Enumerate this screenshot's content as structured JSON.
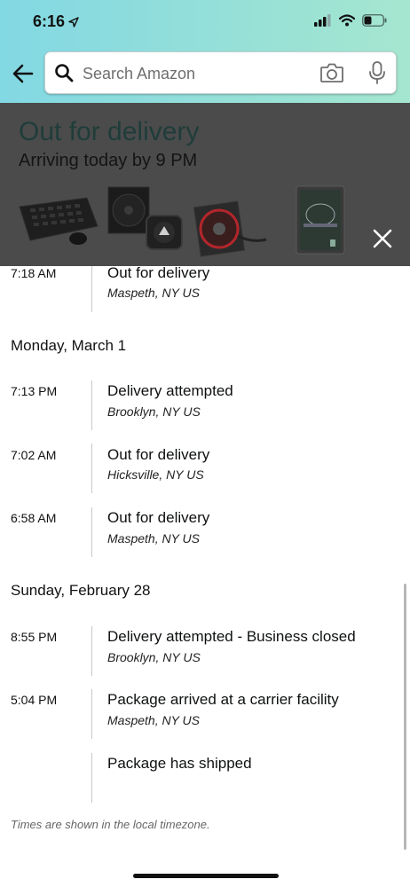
{
  "status_bar": {
    "time": "6:16"
  },
  "search": {
    "placeholder": "Search Amazon"
  },
  "banner": {
    "title": "Out for delivery",
    "subtitle": "Arriving today by 9 PM"
  },
  "timeline": {
    "first_event": {
      "time": "7:18 AM",
      "event": "Out for delivery",
      "location": "Maspeth, NY US"
    },
    "day1": {
      "header": "Monday, March 1",
      "events": [
        {
          "time": "7:13 PM",
          "event": "Delivery attempted",
          "location": "Brooklyn, NY US"
        },
        {
          "time": "7:02 AM",
          "event": "Out for delivery",
          "location": "Hicksville, NY US"
        },
        {
          "time": "6:58 AM",
          "event": "Out for delivery",
          "location": "Maspeth, NY US"
        }
      ]
    },
    "day2": {
      "header": "Sunday, February 28",
      "events": [
        {
          "time": "8:55 PM",
          "event": "Delivery attempted - Business closed",
          "location": "Brooklyn, NY US"
        },
        {
          "time": "5:04 PM",
          "event": "Package arrived at a carrier facility",
          "location": "Maspeth, NY US"
        },
        {
          "time": "",
          "event": "Package has shipped",
          "location": ""
        }
      ]
    }
  },
  "footnote": "Times are shown in the local timezone.",
  "colors": {
    "header_gradient_start": "#82d8e3",
    "header_gradient_end": "#a5e6cf",
    "overlay": "#4b4b4b"
  }
}
